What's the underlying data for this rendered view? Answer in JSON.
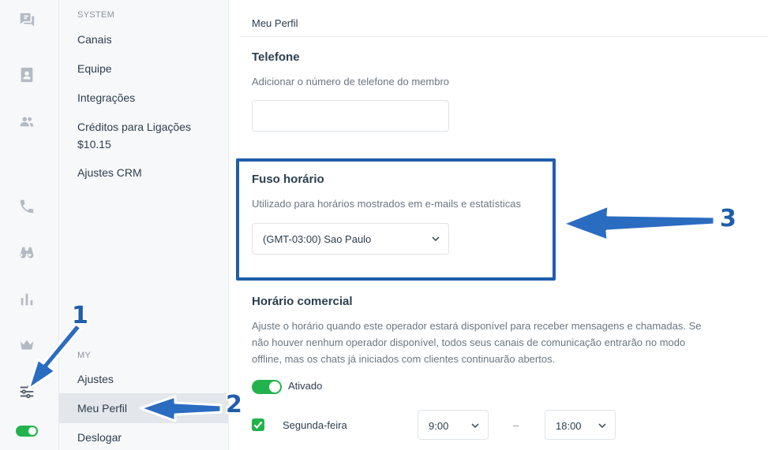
{
  "rail": {
    "icons": [
      "chat-icon",
      "contact-card-icon",
      "team-icon",
      "phone-icon",
      "binoculars-icon",
      "bar-chart-icon",
      "crown-icon",
      "settings-sliders-icon"
    ],
    "status_color": "#22b34c"
  },
  "menu": {
    "system_label": "SYSTEM",
    "system_items": [
      "Canais",
      "Equipe",
      "Integrações",
      "Créditos para Ligações",
      "Ajustes CRM"
    ],
    "credits_value": "$10.15",
    "my_label": "MY",
    "my_items": [
      "Ajustes",
      "Meu Perfil",
      "Deslogar"
    ],
    "active_item": "Meu Perfil"
  },
  "main": {
    "header_title": "Meu Perfil",
    "phone": {
      "title": "Telefone",
      "description": "Adicionar o número de telefone do membro",
      "value": ""
    },
    "timezone": {
      "title": "Fuso horário",
      "description": "Utilizado para horários mostrados em e-mails e estatísticas",
      "selected": "(GMT-03:00) Sao Paulo"
    },
    "business_hours": {
      "title": "Horário comercial",
      "description_lines": [
        "Ajuste o horário quando este operador estará disponível para receber mensagens e chamadas. Se",
        "não houver nenhum operador disponível, todos seus canais de comunicação entrarão no modo",
        "offline, mas os chats já iniciados com clientes continuarão abertos."
      ],
      "toggle_label": "Ativado",
      "toggle_on": true,
      "day": "Segunda-feira",
      "day_checked": true,
      "start": "9:00",
      "separator": "–",
      "end": "18:00"
    }
  },
  "annotations": {
    "step1": "1",
    "step2": "2",
    "step3": "3",
    "color": "#1f5eaa"
  }
}
